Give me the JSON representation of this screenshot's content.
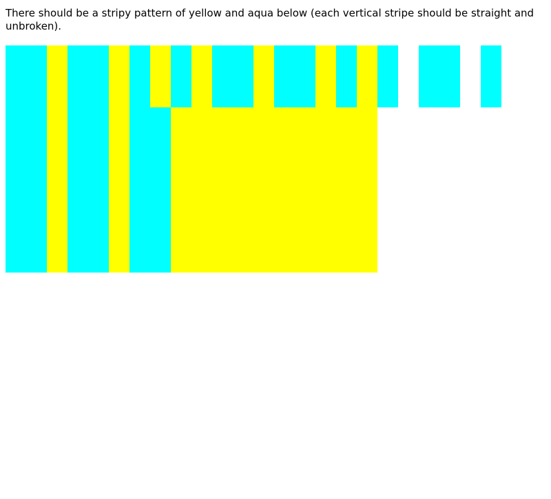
{
  "instructions": {
    "text": "There should be a stripy pattern of yellow and aqua below (each vertical stripe should be straight and unbroken)."
  },
  "colors": {
    "aqua": "#00ffff",
    "yellow": "#ffff00",
    "background": "#ffffff"
  }
}
